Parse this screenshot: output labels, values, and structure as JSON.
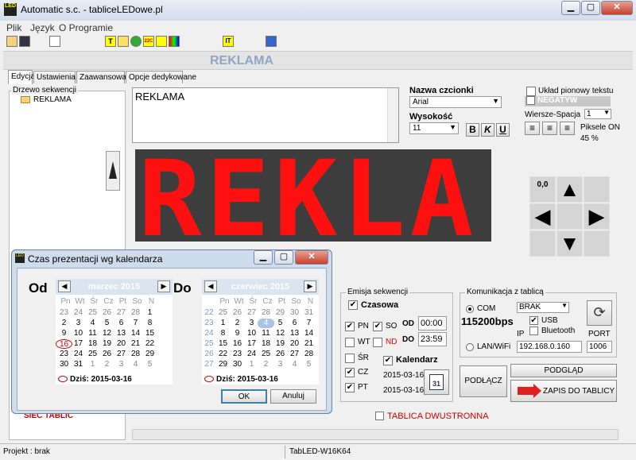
{
  "window": {
    "title": "Automatic s.c. - tabliceLEDowe.pl",
    "app_icon": "LED"
  },
  "menu": [
    "Plik",
    "Język",
    "O Programie"
  ],
  "banner": "REKLAMA",
  "tabs": [
    "Edycja",
    "Ustawienia",
    "Zaawansowane",
    "Opcje dedykowane"
  ],
  "tree": {
    "label": "Drzewo sekwencji",
    "item": "REKLAMA"
  },
  "editor": {
    "text": "REKLAMA"
  },
  "font": {
    "label": "Nazwa czcionki",
    "value": "Arial",
    "height_label": "Wysokość",
    "height_value": "11"
  },
  "style_buttons": [
    "B",
    "K",
    "U"
  ],
  "options": {
    "vertical_label": "Układ pionowy tekstu",
    "negative_label": "NEGATYW",
    "rows_label": "Wiersze-Spacja",
    "rows_value": "1",
    "pixels_label": "Piksele ON",
    "pixels_value": "45 %"
  },
  "led": {
    "text": "REKLA"
  },
  "arrows": {
    "origin": "0,0"
  },
  "emission": {
    "label": "Emisja sekwencji",
    "timed_label": "Czasowa",
    "days": [
      {
        "name": "PN",
        "checked": true
      },
      {
        "name": "WT",
        "checked": false
      },
      {
        "name": "ŚR",
        "checked": false
      },
      {
        "name": "CZ",
        "checked": true
      },
      {
        "name": "PT",
        "checked": true
      },
      {
        "name": "SO",
        "checked": true
      },
      {
        "name": "ND",
        "checked": false
      }
    ],
    "od_label": "OD",
    "od_value": "00:00",
    "do_label": "DO",
    "do_value": "23:59",
    "calendar_label": "Kalendarz",
    "date_from": "2015-03-16",
    "date_to": "2015-03-16",
    "calendar_icon_text": "31"
  },
  "comm": {
    "label": "Komunikacja z tablicą",
    "com_label": "COM",
    "com_value": "BRAK",
    "baud": "115200bps",
    "usb_label": "USB",
    "bluetooth_label": "Bluetooth",
    "lan_label": "LAN/WiFi",
    "ip_label": "IP",
    "ip_value": "192.168.0.160",
    "port_label": "PORT",
    "port_value": "1006"
  },
  "buttons": {
    "connect": "PODŁĄCZ",
    "preview": "PODGLĄD",
    "save": "ZAPIS DO TABLICY"
  },
  "bottom": {
    "net_label": "SIEC TABLIC",
    "double_sided": "TABLICA DWUSTRONNA"
  },
  "status": {
    "project": "Projekt : brak",
    "model": "TabLED-W16K64"
  },
  "dialog": {
    "title": "Czas prezentacji wg kalendarza",
    "from_label": "Od",
    "to_label": "Do",
    "ok": "OK",
    "cancel": "Anuluj",
    "dow": [
      "Pn",
      "Wt",
      "Śr",
      "Cz",
      "Pt",
      "So",
      "N"
    ],
    "from_cal": {
      "month": "marzec 2015",
      "today": "Dziś: 2015-03-16",
      "rows": [
        [
          "23",
          "24",
          "25",
          "26",
          "27",
          "28",
          "1"
        ],
        [
          "2",
          "3",
          "4",
          "5",
          "6",
          "7",
          "8"
        ],
        [
          "9",
          "10",
          "11",
          "12",
          "13",
          "14",
          "15"
        ],
        [
          "16",
          "17",
          "18",
          "19",
          "20",
          "21",
          "22"
        ],
        [
          "23",
          "24",
          "25",
          "26",
          "27",
          "28",
          "29"
        ],
        [
          "30",
          "31",
          "1",
          "2",
          "3",
          "4",
          "5"
        ]
      ]
    },
    "to_cal": {
      "month": "czerwiec 2015",
      "today": "Dziś: 2015-03-16",
      "weeks": [
        "22",
        "23",
        "24",
        "25",
        "26",
        "27"
      ],
      "rows": [
        [
          "25",
          "26",
          "27",
          "28",
          "29",
          "30",
          "31"
        ],
        [
          "1",
          "2",
          "3",
          "4",
          "5",
          "6",
          "7"
        ],
        [
          "8",
          "9",
          "10",
          "11",
          "12",
          "13",
          "14"
        ],
        [
          "15",
          "16",
          "17",
          "18",
          "19",
          "20",
          "21"
        ],
        [
          "22",
          "23",
          "24",
          "25",
          "26",
          "27",
          "28"
        ],
        [
          "29",
          "30",
          "1",
          "2",
          "3",
          "4",
          "5"
        ]
      ]
    }
  }
}
